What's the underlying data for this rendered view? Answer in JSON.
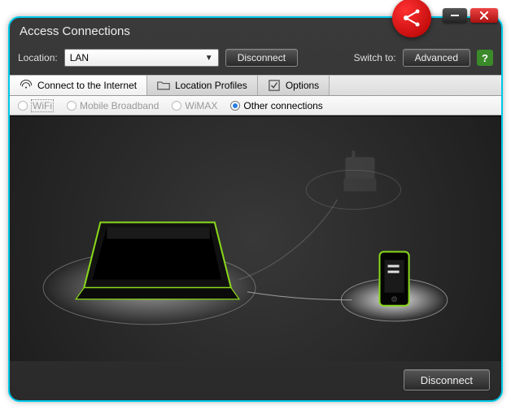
{
  "window": {
    "title": "Access Connections"
  },
  "toolbar": {
    "location_label": "Location:",
    "location_value": "LAN",
    "disconnect_label": "Disconnect",
    "switch_to_label": "Switch to:",
    "advanced_label": "Advanced",
    "help_glyph": "?"
  },
  "tabs": [
    {
      "label": "Connect to the Internet",
      "active": true
    },
    {
      "label": "Location Profiles",
      "active": false
    },
    {
      "label": "Options",
      "active": false
    }
  ],
  "radios": {
    "wifi": "WiFi",
    "mobile_broadband": "Mobile Broadband",
    "wimax": "WiMAX",
    "other": "Other connections"
  },
  "canvas": {
    "devices": {
      "laptop": "laptop",
      "phone": "phone",
      "router": "router (dimmed)"
    }
  },
  "footer": {
    "disconnect_label": "Disconnect"
  },
  "colors": {
    "accent_green": "#8ad81a",
    "badge_red": "#d41414",
    "border_cyan": "#00c8e8"
  }
}
